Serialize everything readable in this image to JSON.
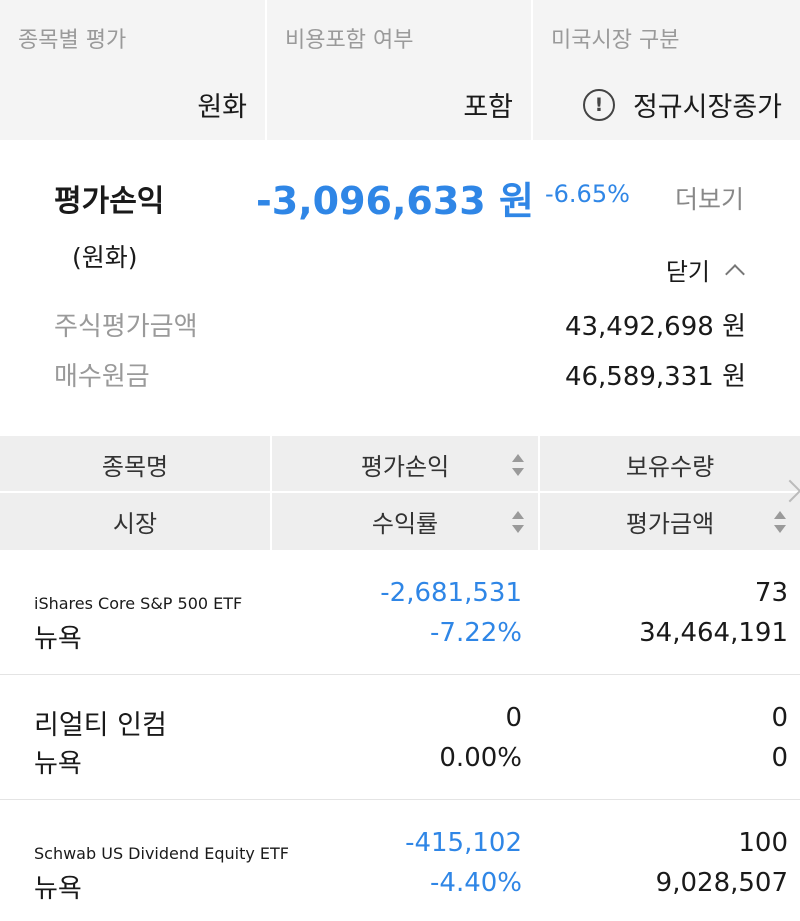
{
  "filters": [
    {
      "label": "종목별 평가",
      "value": "원화"
    },
    {
      "label": "비용포함 여부",
      "value": "포함"
    },
    {
      "label": "미국시장 구분",
      "value": "정규시장종가",
      "icon": "info-icon"
    }
  ],
  "summary": {
    "title": "평가손익",
    "subtitle": "(원화)",
    "amount": "-3,096,633 원",
    "rate": "-6.65%",
    "more_label": "더보기",
    "close_label": "닫기",
    "rows": [
      {
        "label": "주식평가금액",
        "value": "43,492,698 원"
      },
      {
        "label": "매수원금",
        "value": "46,589,331 원"
      }
    ]
  },
  "table_header": {
    "row1": [
      "종목명",
      "평가손익",
      "보유수량"
    ],
    "row2": [
      "시장",
      "수익률",
      "평가금액"
    ]
  },
  "holdings": [
    {
      "name": "iShares Core S&P 500 ETF",
      "market": "뉴욕",
      "pl": "-2,681,531",
      "rate": "-7.22%",
      "qty": "73",
      "eval": "34,464,191"
    },
    {
      "name": "리얼티 인컴",
      "market": "뉴욕",
      "pl": "0",
      "rate": "0.00%",
      "qty": "0",
      "eval": "0"
    },
    {
      "name": "Schwab US Dividend Equity ETF",
      "market": "뉴욕",
      "pl": "-415,102",
      "rate": "-4.40%",
      "qty": "100",
      "eval": "9,028,507"
    }
  ],
  "colors": {
    "negative": "#2f86e6",
    "header_bg": "#eeeeee",
    "filter_bg": "#f4f4f4"
  }
}
